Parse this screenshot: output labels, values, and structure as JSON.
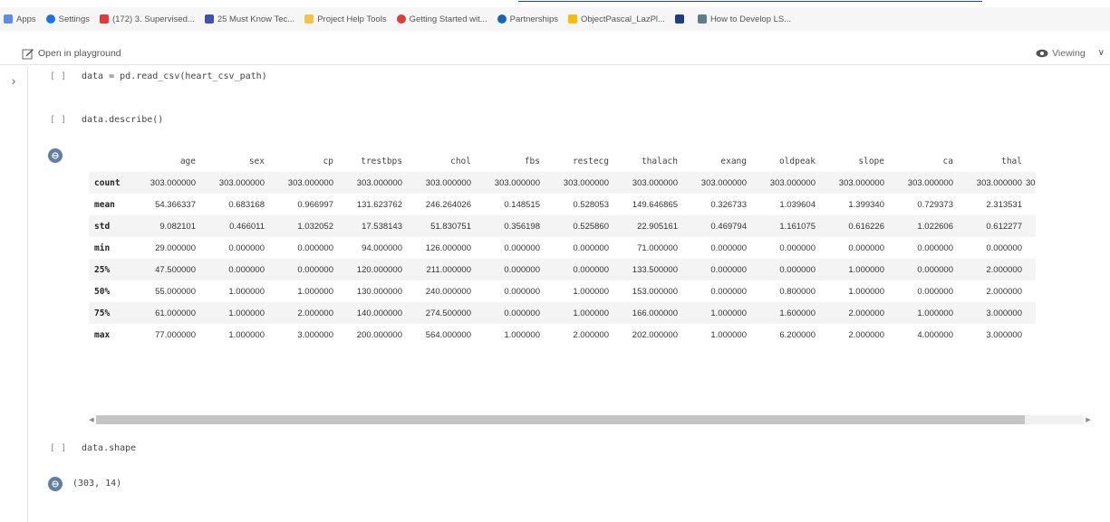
{
  "bookmarks": [
    {
      "label": "Apps",
      "icon": "apps-grid-icon",
      "color": "#5b8def",
      "round": false
    },
    {
      "label": "Settings",
      "icon": "settings-icon",
      "color": "#1a73e8",
      "round": true
    },
    {
      "label": "(172) 3. Supervised...",
      "icon": "youtube-icon",
      "color": "#e53935",
      "round": false
    },
    {
      "label": "25 Must Know Tec...",
      "icon": "chart-bookmark-icon",
      "color": "#3f51b5",
      "round": false
    },
    {
      "label": "Project Help Tools",
      "icon": "folder-icon",
      "color": "#f5c242",
      "round": false
    },
    {
      "label": "Getting Started wit...",
      "icon": "getting-started-icon",
      "color": "#e53935",
      "round": true
    },
    {
      "label": "Partnerships",
      "icon": "partnerships-icon",
      "color": "#1565c0",
      "round": true
    },
    {
      "label": "ObjectPascal_LazPl...",
      "icon": "drive-icon",
      "color": "#fbbc04",
      "round": false
    },
    {
      "label": "",
      "icon": "blue-square-icon",
      "color": "#1a3e8a",
      "round": false
    },
    {
      "label": "How to Develop LS...",
      "icon": "blog-icon",
      "color": "#607d8b",
      "round": false
    }
  ],
  "toolbar": {
    "open_in_playground": "Open in playground",
    "viewing": "Viewing"
  },
  "cells": [
    {
      "bracket": "[ ]",
      "code": "data = pd.read_csv(heart_csv_path)"
    },
    {
      "bracket": "[ ]",
      "code": "data.describe()"
    },
    {
      "bracket": "[ ]",
      "code": "data.shape"
    }
  ],
  "describe_table": {
    "columns": [
      "age",
      "sex",
      "cp",
      "trestbps",
      "chol",
      "fbs",
      "restecg",
      "thalach",
      "exang",
      "oldpeak",
      "slope",
      "ca",
      "thal"
    ],
    "rows": [
      {
        "label": "count",
        "values": [
          "303.000000",
          "303.000000",
          "303.000000",
          "303.000000",
          "303.000000",
          "303.000000",
          "303.000000",
          "303.000000",
          "303.000000",
          "303.000000",
          "303.000000",
          "303.000000",
          "303.000000"
        ],
        "clip": "30"
      },
      {
        "label": "mean",
        "values": [
          "54.366337",
          "0.683168",
          "0.966997",
          "131.623762",
          "246.264026",
          "0.148515",
          "0.528053",
          "149.646865",
          "0.326733",
          "1.039604",
          "1.399340",
          "0.729373",
          "2.313531"
        ],
        "clip": ""
      },
      {
        "label": "std",
        "values": [
          "9.082101",
          "0.466011",
          "1.032052",
          "17.538143",
          "51.830751",
          "0.356198",
          "0.525860",
          "22.905161",
          "0.469794",
          "1.161075",
          "0.616226",
          "1.022606",
          "0.612277"
        ],
        "clip": ""
      },
      {
        "label": "min",
        "values": [
          "29.000000",
          "0.000000",
          "0.000000",
          "94.000000",
          "126.000000",
          "0.000000",
          "0.000000",
          "71.000000",
          "0.000000",
          "0.000000",
          "0.000000",
          "0.000000",
          "0.000000"
        ],
        "clip": ""
      },
      {
        "label": "25%",
        "values": [
          "47.500000",
          "0.000000",
          "0.000000",
          "120.000000",
          "211.000000",
          "0.000000",
          "0.000000",
          "133.500000",
          "0.000000",
          "0.000000",
          "1.000000",
          "0.000000",
          "2.000000"
        ],
        "clip": ""
      },
      {
        "label": "50%",
        "values": [
          "55.000000",
          "1.000000",
          "1.000000",
          "130.000000",
          "240.000000",
          "0.000000",
          "1.000000",
          "153.000000",
          "0.000000",
          "0.800000",
          "1.000000",
          "0.000000",
          "2.000000"
        ],
        "clip": ""
      },
      {
        "label": "75%",
        "values": [
          "61.000000",
          "1.000000",
          "2.000000",
          "140.000000",
          "274.500000",
          "0.000000",
          "1.000000",
          "166.000000",
          "1.000000",
          "1.600000",
          "2.000000",
          "1.000000",
          "3.000000"
        ],
        "clip": ""
      },
      {
        "label": "max",
        "values": [
          "77.000000",
          "1.000000",
          "3.000000",
          "200.000000",
          "564.000000",
          "1.000000",
          "2.000000",
          "202.000000",
          "1.000000",
          "6.200000",
          "2.000000",
          "4.000000",
          "3.000000"
        ],
        "clip": ""
      }
    ]
  },
  "scrollbar": {
    "thumb_fraction": 0.94
  },
  "shape_output": "(303, 14)",
  "colors": {
    "output_icon": "#5f7fa8",
    "link_underline": "#1a47c8"
  }
}
